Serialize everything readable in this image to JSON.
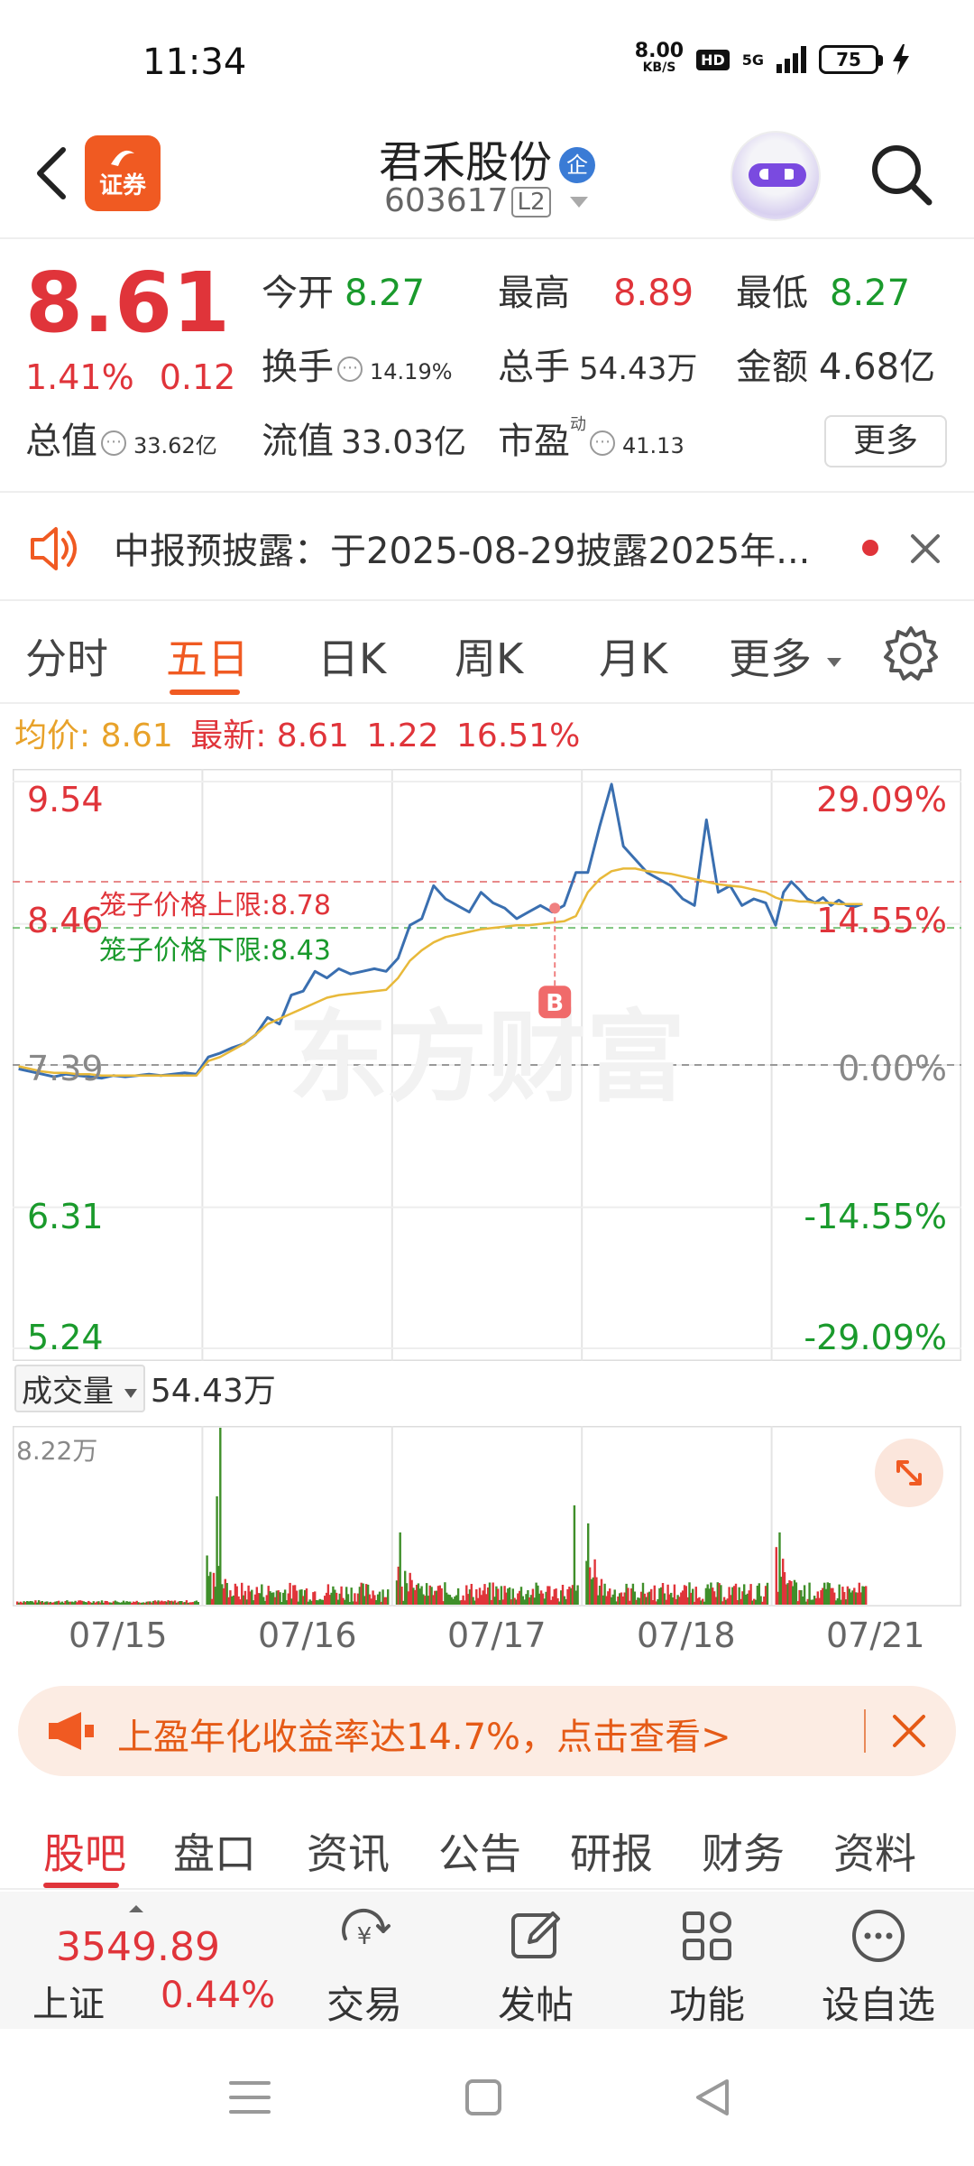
{
  "status_bar": {
    "time": "11:34",
    "net_speed_value": "8.00",
    "net_speed_unit": "KB/S",
    "hd": "HD",
    "signal": "5G",
    "battery": "75"
  },
  "header": {
    "logo_text": "证券",
    "stock_name": "君禾股份",
    "badge": "企",
    "stock_code": "603617",
    "level": "L2"
  },
  "quote": {
    "price": "8.61",
    "change_pct": "1.41%",
    "change_amt": "0.12",
    "open_label": "今开",
    "open": "8.27",
    "high_label": "最高",
    "high": "8.89",
    "low_label": "最低",
    "low": "8.27",
    "turnover_label": "换手",
    "turnover": "14.19%",
    "volume_label": "总手",
    "volume": "54.43万",
    "amount_label": "金额",
    "amount": "4.68亿",
    "mktcap_label": "总值",
    "mktcap": "33.62亿",
    "float_label": "流值",
    "float": "33.03亿",
    "pe_label": "市盈",
    "pe_sup": "动",
    "pe": "41.13",
    "more": "更多"
  },
  "notice": {
    "text": "中报预披露：于2025-08-29披露2025年..."
  },
  "tabs": [
    {
      "label": "分时"
    },
    {
      "label": "五日"
    },
    {
      "label": "日K"
    },
    {
      "label": "周K"
    },
    {
      "label": "月K"
    },
    {
      "label": "更多"
    }
  ],
  "chart_header": {
    "avg_label": "均价:",
    "avg": "8.61",
    "latest_label": "最新:",
    "latest": "8.61",
    "chg": "1.22",
    "pct": "16.51%"
  },
  "chart_data": {
    "type": "line",
    "watermark": "东方财富",
    "y_left_ticks": [
      "9.54",
      "8.46",
      "7.39",
      "6.31",
      "5.24"
    ],
    "y_right_ticks": [
      "29.09%",
      "14.55%",
      "0.00%",
      "-14.55%",
      "-29.09%"
    ],
    "ylim": [
      5.24,
      9.54
    ],
    "prev_close": 7.39,
    "annotations": [
      {
        "label": "笼子价格上限:",
        "value": "8.78"
      },
      {
        "label": "笼子价格下限:",
        "value": "8.43"
      }
    ],
    "marker": "B",
    "x": [
      "07/15",
      "07/16",
      "07/17",
      "07/18",
      "07/21"
    ],
    "series": [
      {
        "role": "price",
        "color": "#3a6fb0",
        "values": [
          [
            7.36,
            7.34,
            7.32,
            7.3,
            7.32,
            7.31,
            7.3,
            7.29,
            7.31,
            7.3,
            7.31,
            7.32,
            7.31,
            7.32,
            7.33,
            7.32
          ],
          [
            7.45,
            7.48,
            7.52,
            7.55,
            7.62,
            7.75,
            7.7,
            7.92,
            7.95,
            8.1,
            8.05,
            8.12,
            8.08,
            8.1,
            8.12,
            8.1
          ],
          [
            8.2,
            8.45,
            8.5,
            8.75,
            8.65,
            8.6,
            8.55,
            8.7,
            8.62,
            8.58,
            8.5,
            8.55,
            8.6,
            8.55,
            8.6,
            8.85
          ],
          [
            8.85,
            9.2,
            9.52,
            9.05,
            8.95,
            8.85,
            8.8,
            8.75,
            8.65,
            8.6,
            9.25,
            8.7,
            8.75,
            8.6,
            8.65,
            8.62
          ],
          [
            8.45,
            8.7,
            8.78,
            8.72,
            8.65,
            8.62,
            8.66,
            8.6,
            8.64,
            8.6,
            8.59,
            8.61
          ]
        ]
      },
      {
        "role": "avg",
        "color": "#e8b93a",
        "values": [
          [
            7.38,
            7.36,
            7.34,
            7.33,
            7.33,
            7.32,
            7.32,
            7.31,
            7.31,
            7.31,
            7.31,
            7.31,
            7.31,
            7.31,
            7.31,
            7.31
          ],
          [
            7.42,
            7.45,
            7.5,
            7.55,
            7.62,
            7.7,
            7.74,
            7.78,
            7.82,
            7.86,
            7.9,
            7.92,
            7.93,
            7.94,
            7.95,
            7.96
          ],
          [
            8.05,
            8.18,
            8.26,
            8.32,
            8.36,
            8.38,
            8.4,
            8.42,
            8.43,
            8.44,
            8.45,
            8.45,
            8.46,
            8.47,
            8.48,
            8.52
          ],
          [
            8.7,
            8.8,
            8.86,
            8.88,
            8.88,
            8.86,
            8.85,
            8.84,
            8.82,
            8.8,
            8.78,
            8.76,
            8.75,
            8.74,
            8.72,
            8.7
          ],
          [
            8.66,
            8.64,
            8.64,
            8.63,
            8.63,
            8.62,
            8.62,
            8.62,
            8.61,
            8.61,
            8.61,
            8.61
          ]
        ]
      }
    ]
  },
  "volume": {
    "label": "成交量",
    "total": "54.43万",
    "max": "8.22万"
  },
  "ad": {
    "text": "上盈年化收益率达14.7%，点击查看>"
  },
  "bottom_tabs": [
    {
      "label": "股吧"
    },
    {
      "label": "盘口"
    },
    {
      "label": "资讯"
    },
    {
      "label": "公告"
    },
    {
      "label": "研报"
    },
    {
      "label": "财务"
    },
    {
      "label": "资料"
    }
  ],
  "bottom_bar": {
    "index_value": "3549.89",
    "index_name": "上证",
    "index_pct": "0.44%",
    "buttons": [
      {
        "label": "交易"
      },
      {
        "label": "发帖"
      },
      {
        "label": "功能"
      },
      {
        "label": "设自选"
      }
    ]
  },
  "colors": {
    "accent": "#f05a22",
    "up": "#e0343a",
    "down": "#1a9a2c",
    "price_line": "#3a6fb0",
    "avg_line": "#e8b93a"
  }
}
